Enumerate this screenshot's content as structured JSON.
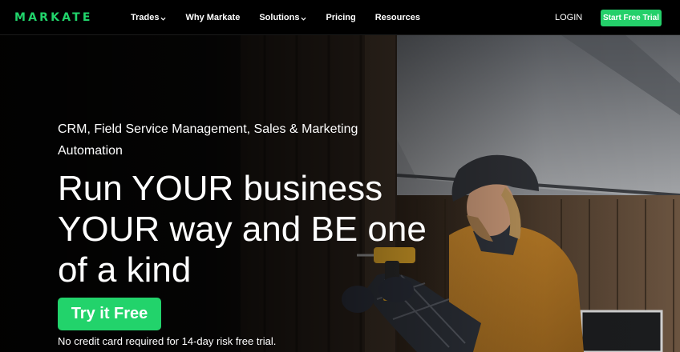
{
  "brand": {
    "logo_text": "MARKATE",
    "accent": "#22d36b"
  },
  "nav": {
    "items": [
      {
        "label": "Trades",
        "has_dropdown": true
      },
      {
        "label": "Why Markate",
        "has_dropdown": false
      },
      {
        "label": "Solutions",
        "has_dropdown": true
      },
      {
        "label": "Pricing",
        "has_dropdown": false
      },
      {
        "label": "Resources",
        "has_dropdown": false
      }
    ],
    "login_label": "LOGIN",
    "cta_label": "Start Free Trial"
  },
  "hero": {
    "eyebrow": "CRM, Field Service Management, Sales & Marketing Automation",
    "headline": "Run YOUR business YOUR way and BE one of a kind",
    "cta_label": "Try it Free",
    "note": "No credit card required for 14-day risk free trial."
  }
}
